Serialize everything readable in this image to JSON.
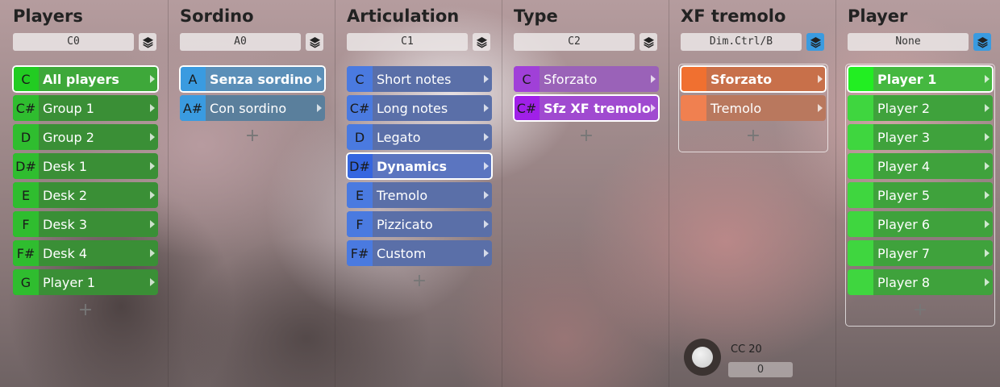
{
  "columns": [
    {
      "title": "Players",
      "key_field": "C0",
      "layers_active": false,
      "items": [
        {
          "key": "C",
          "label": "All players",
          "selected": true,
          "key_color": "#22cc22",
          "bg": "#3ea83a"
        },
        {
          "key": "C#",
          "label": "Group 1",
          "selected": false,
          "key_color": "#2fbd2f",
          "bg": "#3a8f36"
        },
        {
          "key": "D",
          "label": "Group 2",
          "selected": false,
          "key_color": "#2fbd2f",
          "bg": "#3a8f36"
        },
        {
          "key": "D#",
          "label": "Desk 1",
          "selected": false,
          "key_color": "#2fbd2f",
          "bg": "#3a8f36"
        },
        {
          "key": "E",
          "label": "Desk 2",
          "selected": false,
          "key_color": "#2fbd2f",
          "bg": "#3a8f36"
        },
        {
          "key": "F",
          "label": "Desk 3",
          "selected": false,
          "key_color": "#2fbd2f",
          "bg": "#3a8f36"
        },
        {
          "key": "F#",
          "label": "Desk 4",
          "selected": false,
          "key_color": "#2fbd2f",
          "bg": "#3a8f36"
        },
        {
          "key": "G",
          "label": "Player 1",
          "selected": false,
          "key_color": "#2fbd2f",
          "bg": "#3a8f36"
        }
      ],
      "add_label": "+"
    },
    {
      "title": "Sordino",
      "key_field": "A0",
      "layers_active": false,
      "items": [
        {
          "key": "A",
          "label": "Senza sordino",
          "selected": true,
          "key_color": "#3a9be0",
          "bg": "#5b8fb8"
        },
        {
          "key": "A#",
          "label": "Con sordino",
          "selected": false,
          "key_color": "#3a9be0",
          "bg": "#5a7f9c"
        }
      ],
      "add_label": "+"
    },
    {
      "title": "Articulation",
      "key_field": "C1",
      "layers_active": false,
      "items": [
        {
          "key": "C",
          "label": "Short notes",
          "selected": false,
          "key_color": "#4a7ae0",
          "bg": "#5a6fa8"
        },
        {
          "key": "C#",
          "label": "Long notes",
          "selected": false,
          "key_color": "#4a7ae0",
          "bg": "#5a6fa8"
        },
        {
          "key": "D",
          "label": "Legato",
          "selected": false,
          "key_color": "#4a7ae0",
          "bg": "#5a6fa8"
        },
        {
          "key": "D#",
          "label": "Dynamics",
          "selected": true,
          "key_color": "#3566e0",
          "bg": "#5b75c0"
        },
        {
          "key": "E",
          "label": "Tremolo",
          "selected": false,
          "key_color": "#4a7ae0",
          "bg": "#5a6fa8"
        },
        {
          "key": "F",
          "label": "Pizzicato",
          "selected": false,
          "key_color": "#4a7ae0",
          "bg": "#5a6fa8"
        },
        {
          "key": "F#",
          "label": "Custom",
          "selected": false,
          "key_color": "#4a7ae0",
          "bg": "#5a6fa8"
        }
      ],
      "add_label": "+"
    },
    {
      "title": "Type",
      "key_field": "C2",
      "layers_active": false,
      "items": [
        {
          "key": "C",
          "label": "Sforzato",
          "selected": false,
          "key_color": "#a040d8",
          "bg": "#9a62b8"
        },
        {
          "key": "C#",
          "label": "Sfz XF tremolo",
          "selected": true,
          "key_color": "#a020e8",
          "bg": "#a04ad0"
        }
      ],
      "add_label": "+"
    },
    {
      "title": "XF tremolo",
      "key_field": "Dim.Ctrl/B",
      "layers_active": true,
      "items": [
        {
          "key": "",
          "label": "Sforzato",
          "selected": true,
          "key_color": "#f07030",
          "bg": "#c8704a"
        },
        {
          "key": "",
          "label": "Tremolo",
          "selected": false,
          "key_color": "#f08050",
          "bg": "#b9785e"
        }
      ],
      "add_label": "+",
      "cc_label": "CC 20",
      "cc_value": "0"
    },
    {
      "title": "Player",
      "key_field": "None",
      "layers_active": true,
      "items": [
        {
          "key": "",
          "label": "Player 1",
          "selected": true,
          "key_color": "#22ee22",
          "bg": "#45b840"
        },
        {
          "key": "",
          "label": "Player 2",
          "selected": false,
          "key_color": "#3fd63f",
          "bg": "#3fa23c"
        },
        {
          "key": "",
          "label": "Player 3",
          "selected": false,
          "key_color": "#3fd63f",
          "bg": "#3fa23c"
        },
        {
          "key": "",
          "label": "Player 4",
          "selected": false,
          "key_color": "#3fd63f",
          "bg": "#3fa23c"
        },
        {
          "key": "",
          "label": "Player 5",
          "selected": false,
          "key_color": "#3fd63f",
          "bg": "#3fa23c"
        },
        {
          "key": "",
          "label": "Player 6",
          "selected": false,
          "key_color": "#3fd63f",
          "bg": "#3fa23c"
        },
        {
          "key": "",
          "label": "Player 7",
          "selected": false,
          "key_color": "#3fd63f",
          "bg": "#3fa23c"
        },
        {
          "key": "",
          "label": "Player 8",
          "selected": false,
          "key_color": "#3fd63f",
          "bg": "#3fa23c"
        }
      ],
      "add_label": "+"
    }
  ]
}
